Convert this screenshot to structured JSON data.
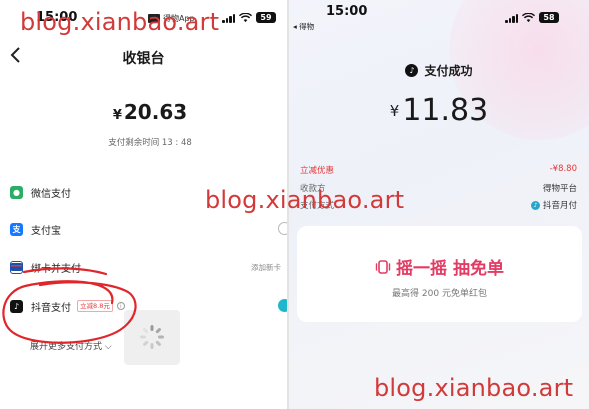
{
  "left": {
    "status_time": "15:00",
    "app_badge": "得物App",
    "battery": "59",
    "title": "收银台",
    "amount_currency": "¥",
    "amount": "20.63",
    "countdown": "支付剩余时间 13 : 48",
    "methods": [
      {
        "label": "微信支付",
        "icon": "wechat-pay-icon"
      },
      {
        "label": "支付宝",
        "icon": "alipay-icon"
      },
      {
        "label": "绑卡并支付",
        "icon": "bank-card-icon",
        "extra": "添加新卡"
      },
      {
        "label": "抖音支付",
        "icon": "douyin-pay-icon",
        "promo": "立减8.8元"
      }
    ],
    "expand_label": "展开更多支付方式"
  },
  "right": {
    "status_time": "15:00",
    "battery": "58",
    "back_app": "◂ 得物",
    "success_label": "支付成功",
    "amount_currency": "¥",
    "amount": "11.83",
    "details": [
      {
        "label": "立减优惠",
        "value": "-¥8.80"
      },
      {
        "label": "收款方",
        "value": "得物平台"
      },
      {
        "label": "支付方式",
        "value": "抖音月付"
      }
    ],
    "card_title": "摇一摇 抽免单",
    "card_subtitle": "最高得 200 元免单红包"
  },
  "watermark": "blog.xianbao.art",
  "colors": {
    "accent_red": "#e5383b",
    "shake_pink": "#e33b63",
    "selected_teal": "#1fb7c9",
    "wechat_green": "#2aae67",
    "alipay_blue": "#1677ff",
    "annotation_red": "#e0262b"
  }
}
